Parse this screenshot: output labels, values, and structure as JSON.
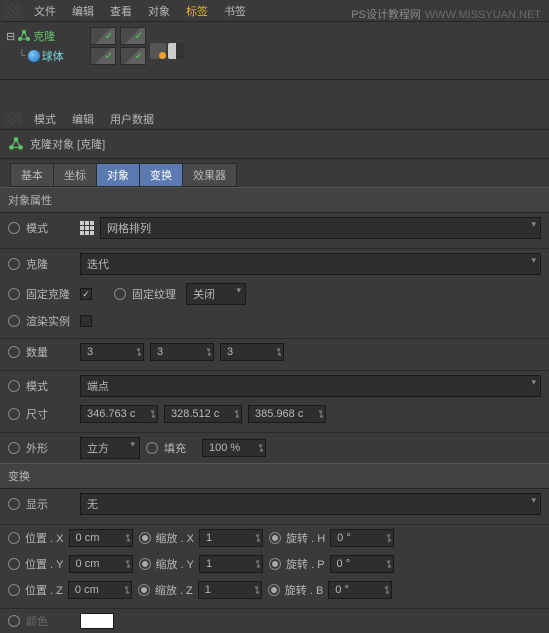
{
  "watermark": {
    "text1": "PS设计教程网",
    "text2": "WWW.MISSYUAN.NET"
  },
  "menu": {
    "file": "文件",
    "edit": "编辑",
    "view": "查看",
    "object": "对象",
    "tags": "标签",
    "bookmarks": "书签"
  },
  "tree": {
    "cloner": "克隆",
    "sphere": "球体"
  },
  "submenu": {
    "mode": "模式",
    "edit": "编辑",
    "userdata": "用户数据"
  },
  "header": {
    "title": "克隆对象 [克隆]"
  },
  "tabs": {
    "basic": "基本",
    "coord": "坐标",
    "object": "对象",
    "transform": "变换",
    "effector": "效果器"
  },
  "section": {
    "objprops": "对象属性",
    "transform": "变换"
  },
  "props": {
    "mode_label": "模式",
    "mode_value": "网格排列",
    "clone_label": "克隆",
    "clone_value": "迭代",
    "fixclone_label": "固定克隆",
    "fixtex_label": "固定纹理",
    "fixtex_value": "关闭",
    "renderinst_label": "渲染实例",
    "count_label": "数量",
    "count_x": "3",
    "count_y": "3",
    "count_z": "3",
    "mode2_label": "模式",
    "mode2_value": "端点",
    "size_label": "尺寸",
    "size_x": "346.763 c",
    "size_y": "328.512 c",
    "size_z": "385.968 c",
    "shape_label": "外形",
    "shape_value": "立方",
    "fill_label": "填充",
    "fill_value": "100 %",
    "display_label": "显示",
    "display_value": "无",
    "pos": "位置",
    "scale": "缩放",
    "rot": "旋转",
    "px": "0 cm",
    "py": "0 cm",
    "pz": "0 cm",
    "sx": "1",
    "sy": "1",
    "sz": "1",
    "rh": "0 °",
    "rp": "0 °",
    "rb": "0 °",
    "color_label": "颜色"
  }
}
